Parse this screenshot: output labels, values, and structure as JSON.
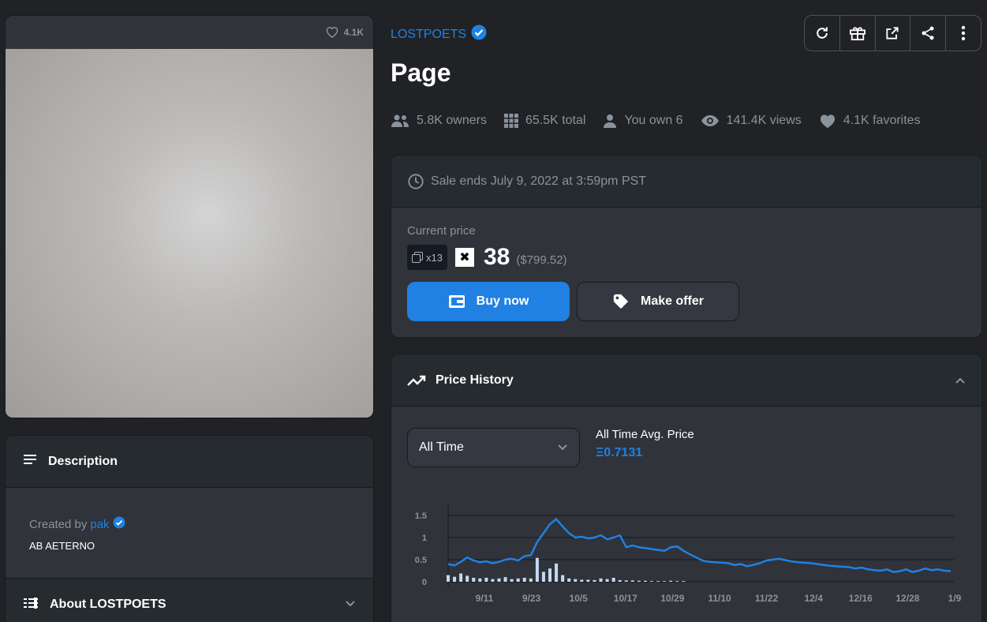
{
  "media": {
    "favorites": "4.1K"
  },
  "description": {
    "heading": "Description",
    "created_by_prefix": "Created by",
    "creator": "pak",
    "text": "AB AETERNO"
  },
  "about": {
    "heading": "About LOSTPOETS"
  },
  "collection": {
    "name": "LOSTPOETS"
  },
  "item": {
    "title": "Page"
  },
  "toolbar": {
    "icons": [
      "refresh-icon",
      "gift-icon",
      "external-link-icon",
      "share-icon",
      "more-icon"
    ]
  },
  "stats": {
    "owners": "5.8K owners",
    "total": "65.5K total",
    "you_own": "You own 6",
    "views": "141.4K views",
    "favorites": "4.1K favorites"
  },
  "sale": {
    "ends": "Sale ends July 9, 2022 at 3:59pm PST",
    "current_price_label": "Current price",
    "quantity": "x13",
    "price": "38",
    "price_usd": "($799.52)",
    "buy_label": "Buy now",
    "offer_label": "Make offer"
  },
  "price_history": {
    "heading": "Price History",
    "range_selected": "All Time",
    "avg_label": "All Time Avg. Price",
    "avg_value": "Ξ0.7131"
  },
  "colors": {
    "accent": "#2081e2",
    "bg": "#202225",
    "panel": "#303339",
    "header": "#262b2f"
  },
  "chart_data": {
    "type": "line",
    "xlabel": "",
    "ylabel": "",
    "ylim": [
      0,
      1.5
    ],
    "y_ticks": [
      "1.5",
      "1",
      "0.5",
      "0"
    ],
    "x_ticks": [
      "9/11",
      "9/23",
      "10/5",
      "10/17",
      "10/29",
      "11/10",
      "11/22",
      "12/4",
      "12/16",
      "12/28",
      "1/9"
    ],
    "series": [
      {
        "values": [
          0.4,
          0.37,
          0.45,
          0.55,
          0.48,
          0.44,
          0.46,
          0.42,
          0.45,
          0.5,
          0.52,
          0.48,
          0.58,
          0.6,
          0.9,
          1.1,
          1.3,
          1.42,
          1.25,
          1.1,
          1.0,
          1.02,
          0.98,
          1.0,
          1.05,
          0.96,
          1.0,
          1.05,
          0.78,
          0.82,
          0.78,
          0.76,
          0.74,
          0.72,
          0.7,
          0.78,
          0.8,
          0.7,
          0.62,
          0.55,
          0.48,
          0.45,
          0.44,
          0.43,
          0.42,
          0.38,
          0.4,
          0.35,
          0.38,
          0.42,
          0.48,
          0.5,
          0.52,
          0.49,
          0.46,
          0.44,
          0.43,
          0.42,
          0.4,
          0.38,
          0.36,
          0.35,
          0.34,
          0.33,
          0.3,
          0.32,
          0.28,
          0.26,
          0.25,
          0.28,
          0.22,
          0.24,
          0.28,
          0.22,
          0.25,
          0.3,
          0.26,
          0.28,
          0.25,
          0.24
        ]
      }
    ],
    "volume": [
      0.2,
      0.15,
      0.25,
      0.18,
      0.12,
      0.1,
      0.12,
      0.08,
      0.1,
      0.14,
      0.08,
      0.1,
      0.12,
      0.1,
      0.72,
      0.3,
      0.4,
      0.55,
      0.2,
      0.1,
      0.08,
      0.06,
      0.06,
      0.05,
      0.1,
      0.08,
      0.12,
      0.05,
      0.04,
      0.04,
      0.03,
      0.03,
      0.02,
      0.02,
      0.02,
      0.03,
      0.02,
      0.02,
      0.01,
      0.01,
      0.01,
      0.01,
      0.01,
      0.01,
      0.01,
      0.01,
      0.01,
      0.01,
      0.01,
      0.01,
      0.01,
      0.01,
      0.01,
      0.01,
      0.01,
      0.01,
      0.01,
      0.01,
      0.01,
      0.01,
      0.01,
      0.01,
      0.01,
      0.01,
      0.01,
      0.01,
      0.01,
      0.01,
      0.01,
      0.01,
      0.01,
      0.01,
      0.01,
      0.01,
      0.01,
      0.01,
      0.01,
      0.01,
      0.01,
      0.01
    ]
  }
}
